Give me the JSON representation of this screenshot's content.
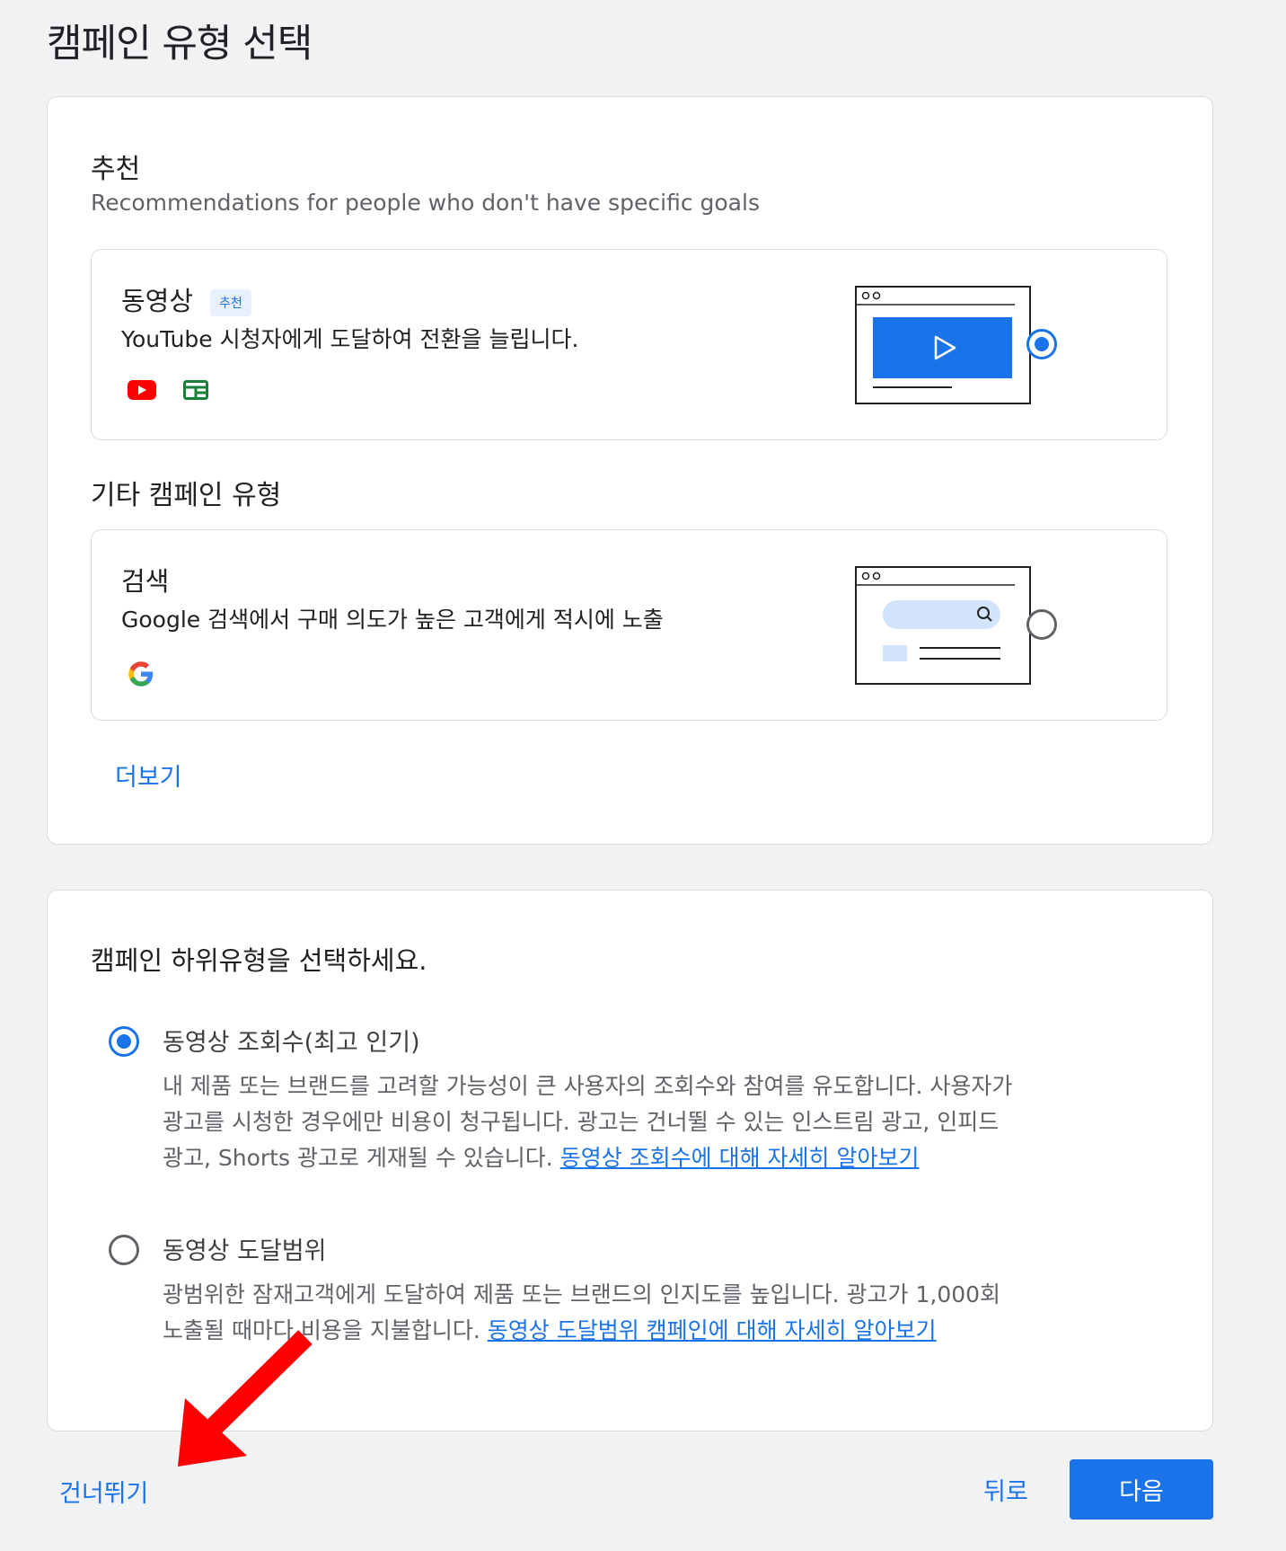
{
  "page_title": "캠페인 유형 선택",
  "recommended_section": {
    "heading": "추천",
    "subtitle": "Recommendations for people who don't have specific goals",
    "option": {
      "title": "동영상",
      "badge": "추천",
      "description": "YouTube 시청자에게 도달하여 전환을 늘립니다.",
      "icons": [
        "youtube-icon",
        "display-network-icon"
      ],
      "illustration": "video-player-illustration",
      "selected": true
    }
  },
  "other_section": {
    "heading": "기타 캠페인 유형",
    "option": {
      "title": "검색",
      "description": "Google 검색에서 구매 의도가 높은 고객에게 적시에 노출",
      "icons": [
        "google-icon"
      ],
      "illustration": "search-results-illustration",
      "selected": false
    }
  },
  "more_link": "더보기",
  "subtype_section": {
    "heading": "캠페인 하위유형을 선택하세요.",
    "options": [
      {
        "label": "동영상 조회수(최고 인기)",
        "selected": true,
        "desc_lines": [
          "내 제품 또는 브랜드를 고려할 가능성이 큰 사용자의 조회수와 참여를 유도합니다. 사용자가",
          "광고를 시청한 경우에만 비용이 청구됩니다. 광고는 건너뛸 수 있는 인스트림 광고, 인피드",
          "광고, Shorts 광고로 게재될 수 있습니다."
        ],
        "link": "동영상 조회수에 대해 자세히 알아보기"
      },
      {
        "label": "동영상 도달범위",
        "selected": false,
        "desc_lines": [
          "광범위한 잠재고객에게 도달하여 제품 또는 브랜드의 인지도를 높입니다. 광고가 1,000회",
          "노출될 때마다 비용을 지불합니다."
        ],
        "link": "동영상 도달범위 캠페인에 대해 자세히 알아보기"
      }
    ]
  },
  "footer": {
    "skip": "건너뛰기",
    "back": "뒤로",
    "next": "다음"
  },
  "colors": {
    "accent": "#1a73e8",
    "background": "#f0f2f4",
    "annotation_arrow": "#ff0000"
  }
}
